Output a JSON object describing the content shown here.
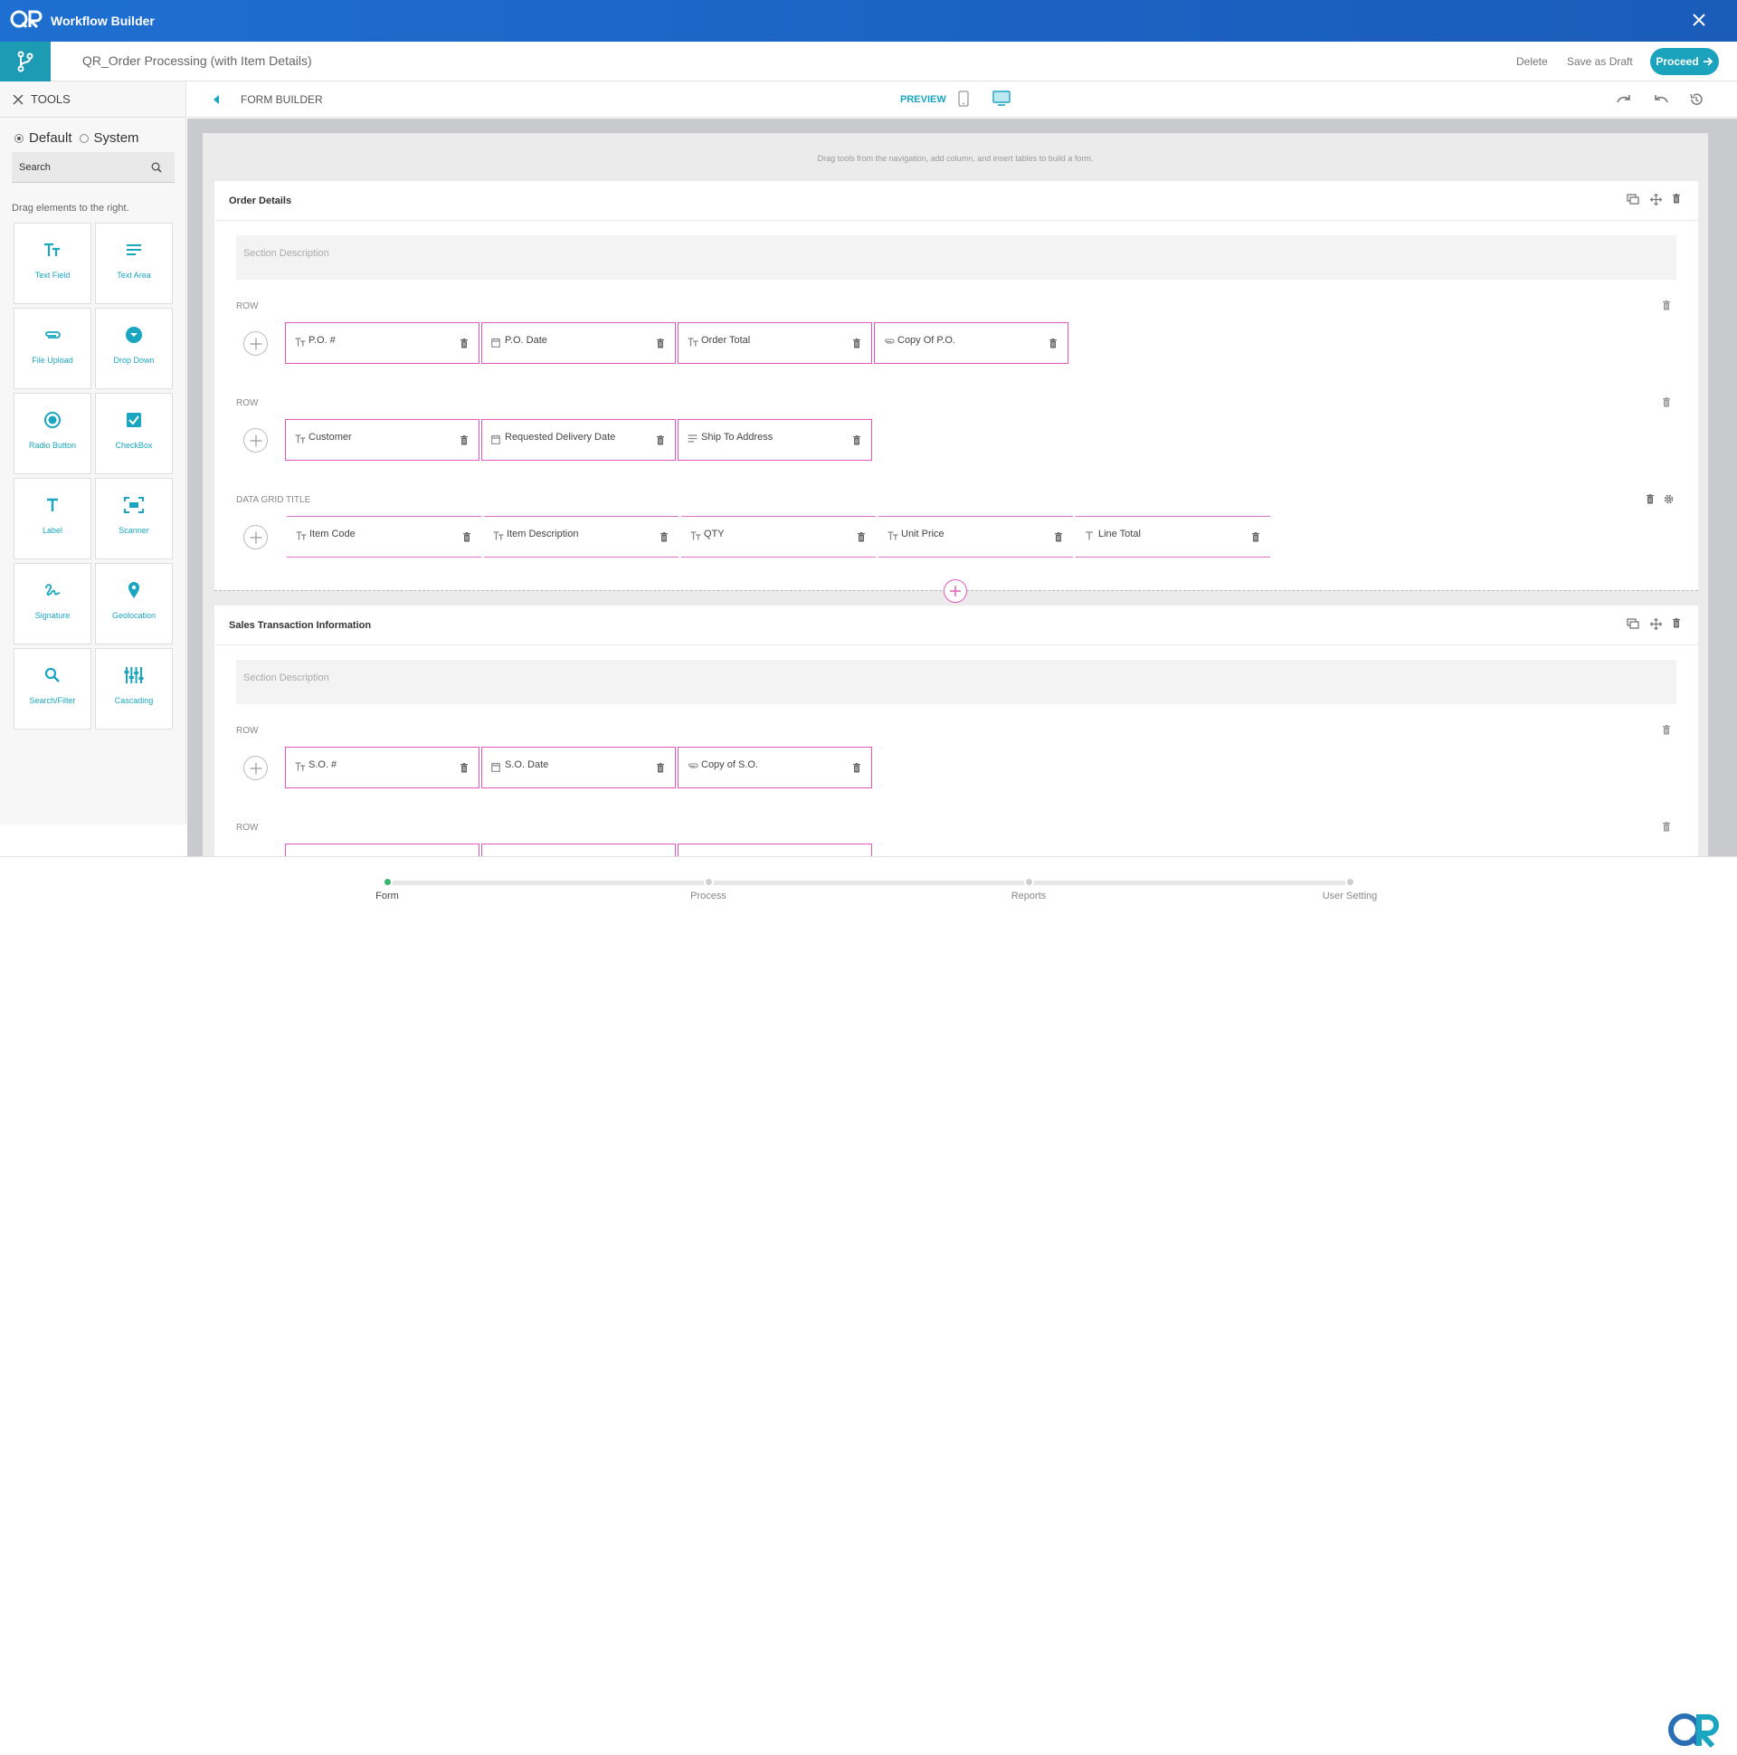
{
  "window": {
    "title": "Workflow Builder"
  },
  "header": {
    "document_title": "QR_Order Processing (with Item Details)",
    "delete_label": "Delete",
    "save_draft_label": "Save as Draft",
    "proceed_label": "Proceed"
  },
  "tools": {
    "title": "TOOLS",
    "mode_options": [
      "Default",
      "System"
    ],
    "selected_mode": "Default",
    "search_placeholder": "Search",
    "hint": "Drag elements to the right.",
    "items": [
      {
        "label": "Text Field",
        "icon": "text-field-icon"
      },
      {
        "label": "Text Area",
        "icon": "text-area-icon"
      },
      {
        "label": "File Upload",
        "icon": "paperclip-icon"
      },
      {
        "label": "Drop Down",
        "icon": "dropdown-icon"
      },
      {
        "label": "Radio Button",
        "icon": "radio-icon"
      },
      {
        "label": "CheckBox",
        "icon": "checkbox-icon"
      },
      {
        "label": "Label",
        "icon": "label-icon"
      },
      {
        "label": "Scanner",
        "icon": "scanner-icon"
      },
      {
        "label": "Signature",
        "icon": "signature-icon"
      },
      {
        "label": "Geolocation",
        "icon": "location-pin-icon"
      },
      {
        "label": "Search/Filter",
        "icon": "search-icon"
      },
      {
        "label": "Cascading",
        "icon": "cascading-icon"
      }
    ]
  },
  "form_builder": {
    "title": "FORM BUILDER",
    "preview_label": "PREVIEW",
    "hint": "Drag tools from the navigation, add column, and insert tables to build a form."
  },
  "sections": [
    {
      "title": "Order Details",
      "description_placeholder": "Section Description",
      "row_label": "ROW",
      "rows": [
        [
          {
            "label": "P.O. #",
            "icon": "text-type-icon"
          },
          {
            "label": "P.O. Date",
            "icon": "calendar-icon"
          },
          {
            "label": "Order Total",
            "icon": "text-type-icon"
          },
          {
            "label": "Copy Of P.O.",
            "icon": "attachment-icon"
          }
        ],
        [
          {
            "label": "Customer",
            "icon": "text-type-icon"
          },
          {
            "label": "Requested Delivery Date",
            "icon": "calendar-icon"
          },
          {
            "label": "Ship To Address",
            "icon": "text-area-icon"
          }
        ]
      ],
      "grid_title": "DATA GRID TITLE",
      "grid_columns": [
        {
          "label": "Item Code",
          "icon": "text-type-icon"
        },
        {
          "label": "Item Description",
          "icon": "text-type-icon"
        },
        {
          "label": "QTY",
          "icon": "text-type-icon"
        },
        {
          "label": "Unit Price",
          "icon": "text-type-icon"
        },
        {
          "label": "Line Total",
          "icon": "label-icon"
        }
      ]
    },
    {
      "title": "Sales Transaction Information",
      "description_placeholder": "Section Description",
      "row_label": "ROW",
      "rows": [
        [
          {
            "label": "S.O. #",
            "icon": "text-type-icon"
          },
          {
            "label": "S.O. Date",
            "icon": "calendar-icon"
          },
          {
            "label": "Copy of S.O.",
            "icon": "attachment-icon"
          }
        ]
      ]
    }
  ],
  "steps": [
    {
      "label": "Form",
      "active": true
    },
    {
      "label": "Process",
      "active": false
    },
    {
      "label": "Reports",
      "active": false
    },
    {
      "label": "User Setting",
      "active": false
    }
  ],
  "colors": {
    "brand_blue": "#1e6fd1",
    "accent_teal": "#1aa6c0",
    "field_border_pink": "#e455ba",
    "active_step_green": "#3bb56a"
  }
}
